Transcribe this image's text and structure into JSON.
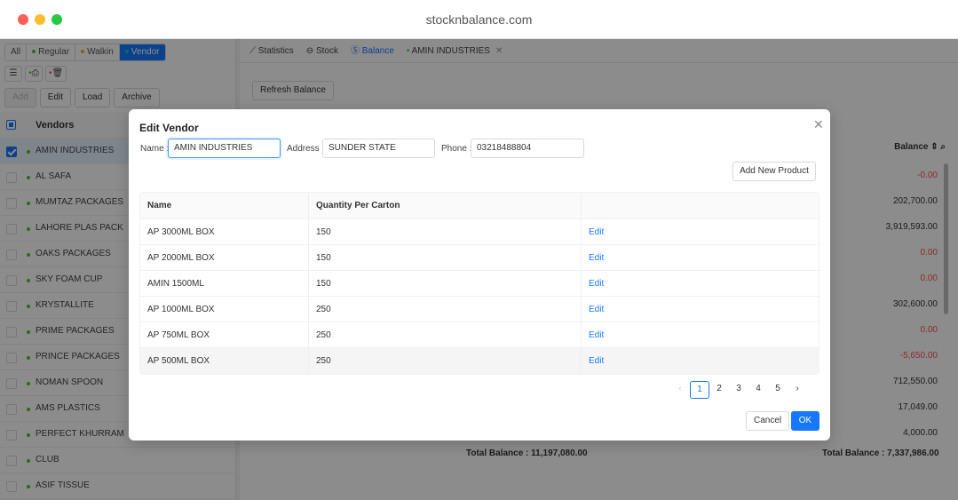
{
  "browser": {
    "url": "stocknbalance.com"
  },
  "left": {
    "filters": [
      {
        "label": "All",
        "dot": ""
      },
      {
        "label": "Regular",
        "dot": "#52c41a"
      },
      {
        "label": "Walkin",
        "dot": "#faad14"
      },
      {
        "label": "Vendor",
        "dot": "#13c2c2"
      }
    ],
    "actions": {
      "add": "Add",
      "edit": "Edit",
      "load": "Load",
      "archive": "Archive"
    },
    "vendors_header": "Vendors",
    "vendors": [
      "AMIN INDUSTRIES",
      "AL SAFA",
      "MUMTAZ PACKAGES",
      "LAHORE PLAS PACK",
      "OAKS PACKAGES",
      "SKY FOAM CUP",
      "KRYSTALLITE",
      "PRIME PACKAGES",
      "PRINCE PACKAGES",
      "NOMAN SPOON",
      "AMS PLASTICS",
      "PERFECT KHURRAM",
      "CLUB",
      "ASIF TISSUE"
    ]
  },
  "right": {
    "tabs": [
      {
        "label": "Statistics",
        "icon": "📈"
      },
      {
        "label": "Stock",
        "icon": "⊖"
      },
      {
        "label": "Balance",
        "icon": "Ⓢ"
      },
      {
        "label": "AMIN INDUSTRIES",
        "icon": "●"
      }
    ],
    "refresh_label": "Refresh Balance",
    "balance_header": "Balance ⇕ ⌕",
    "balances": [
      {
        "v": "-0.00",
        "red": true
      },
      {
        "v": "202,700.00",
        "red": false
      },
      {
        "v": "3,919,593.00",
        "red": false
      },
      {
        "v": "0.00",
        "red": true
      },
      {
        "v": "0.00",
        "red": true
      },
      {
        "v": "302,600.00",
        "red": false
      },
      {
        "v": "0.00",
        "red": true
      },
      {
        "v": "-5,650.00",
        "red": true
      },
      {
        "v": "712,550.00",
        "red": false
      },
      {
        "v": "17,049.00",
        "red": false
      },
      {
        "v": "4,000.00",
        "red": false
      }
    ],
    "total_left": "Total Balance : 11,197,080.00",
    "total_right": "Total Balance : 7,337,986.00"
  },
  "modal": {
    "title": "Edit Vendor",
    "name_label": "Name :",
    "name_value": "AMIN INDUSTRIES",
    "address_label": "Address :",
    "address_value": "SUNDER STATE",
    "phone_label": "Phone :",
    "phone_value": "03218488804",
    "add_product": "Add New Product",
    "columns": [
      "Name",
      "Quantity Per Carton",
      ""
    ],
    "rows": [
      {
        "name": "AP 3000ML BOX",
        "qty": "150",
        "action": "Edit"
      },
      {
        "name": "AP 2000ML BOX",
        "qty": "150",
        "action": "Edit"
      },
      {
        "name": "AMIN 1500ML",
        "qty": "150",
        "action": "Edit"
      },
      {
        "name": "AP 1000ML BOX",
        "qty": "250",
        "action": "Edit"
      },
      {
        "name": "AP 750ML BOX",
        "qty": "250",
        "action": "Edit"
      },
      {
        "name": "AP 500ML BOX",
        "qty": "250",
        "action": "Edit"
      }
    ],
    "pages": [
      "1",
      "2",
      "3",
      "4",
      "5"
    ],
    "cancel": "Cancel",
    "ok": "OK"
  }
}
